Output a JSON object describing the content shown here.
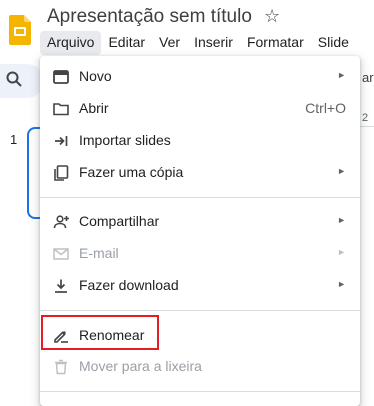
{
  "header": {
    "title": "Apresentação sem título",
    "star_icon": "star-icon"
  },
  "menubar": [
    "Arquivo",
    "Editar",
    "Ver",
    "Inserir",
    "Formatar",
    "Slide"
  ],
  "background": {
    "right_fragment": "ar",
    "ruler_tick": "2",
    "slide_number": "1"
  },
  "file_menu": {
    "items": [
      {
        "label": "Novo",
        "icon": "presentation-icon",
        "submenu": true
      },
      {
        "label": "Abrir",
        "icon": "folder-icon",
        "shortcut": "Ctrl+O"
      },
      {
        "label": "Importar slides",
        "icon": "import-icon"
      },
      {
        "label": "Fazer uma cópia",
        "icon": "copy-icon",
        "submenu": true
      },
      {
        "label": "Compartilhar",
        "icon": "share-person-icon",
        "submenu": true
      },
      {
        "label": "E-mail",
        "icon": "email-icon",
        "submenu": true,
        "disabled": true
      },
      {
        "label": "Fazer download",
        "icon": "download-icon",
        "submenu": true
      },
      {
        "label": "Renomear",
        "icon": "rename-icon",
        "highlighted": true
      },
      {
        "label": "Mover para a lixeira",
        "icon": "trash-icon",
        "disabled": true
      }
    ],
    "submenu_glyph": "►"
  },
  "colors": {
    "highlight_border": "#e31e24",
    "accent": "#1a73e8",
    "slides_logo": "#f4b400"
  }
}
